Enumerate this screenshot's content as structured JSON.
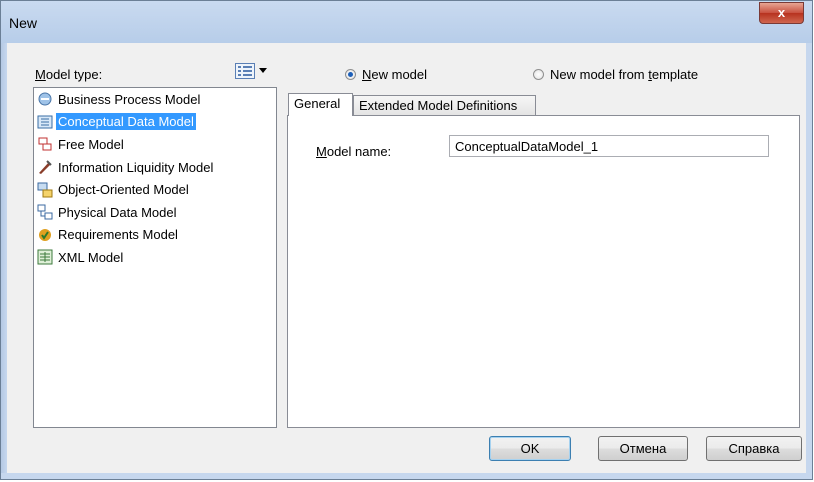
{
  "window": {
    "title": "New",
    "close_glyph": "x"
  },
  "model_type": {
    "label_first": "M",
    "label_rest": "odel type:",
    "view_icon": "list-view-icon",
    "items": [
      {
        "label": "Business Process Model",
        "icon": "business-process-icon"
      },
      {
        "label": "Conceptual Data Model",
        "icon": "conceptual-data-icon",
        "selected": true
      },
      {
        "label": "Free Model",
        "icon": "free-model-icon"
      },
      {
        "label": "Information Liquidity Model",
        "icon": "information-liquidity-icon"
      },
      {
        "label": "Object-Oriented Model",
        "icon": "object-oriented-icon"
      },
      {
        "label": "Physical Data Model",
        "icon": "physical-data-icon"
      },
      {
        "label": "Requirements Model",
        "icon": "requirements-icon"
      },
      {
        "label": "XML Model",
        "icon": "xml-model-icon"
      }
    ]
  },
  "options": {
    "new_model_first": "N",
    "new_model_rest": "ew model",
    "template_prefix": "New model from ",
    "template_accel": "t",
    "template_rest": "emplate",
    "selected": "new_model"
  },
  "tabs": {
    "general": "General",
    "extended": "Extended Model Definitions"
  },
  "general": {
    "name_label_first": "M",
    "name_label_rest": "odel name:",
    "name_value": "ConceptualDataModel_1"
  },
  "buttons": {
    "ok": "OK",
    "cancel": "Отмена",
    "help": "Справка"
  }
}
